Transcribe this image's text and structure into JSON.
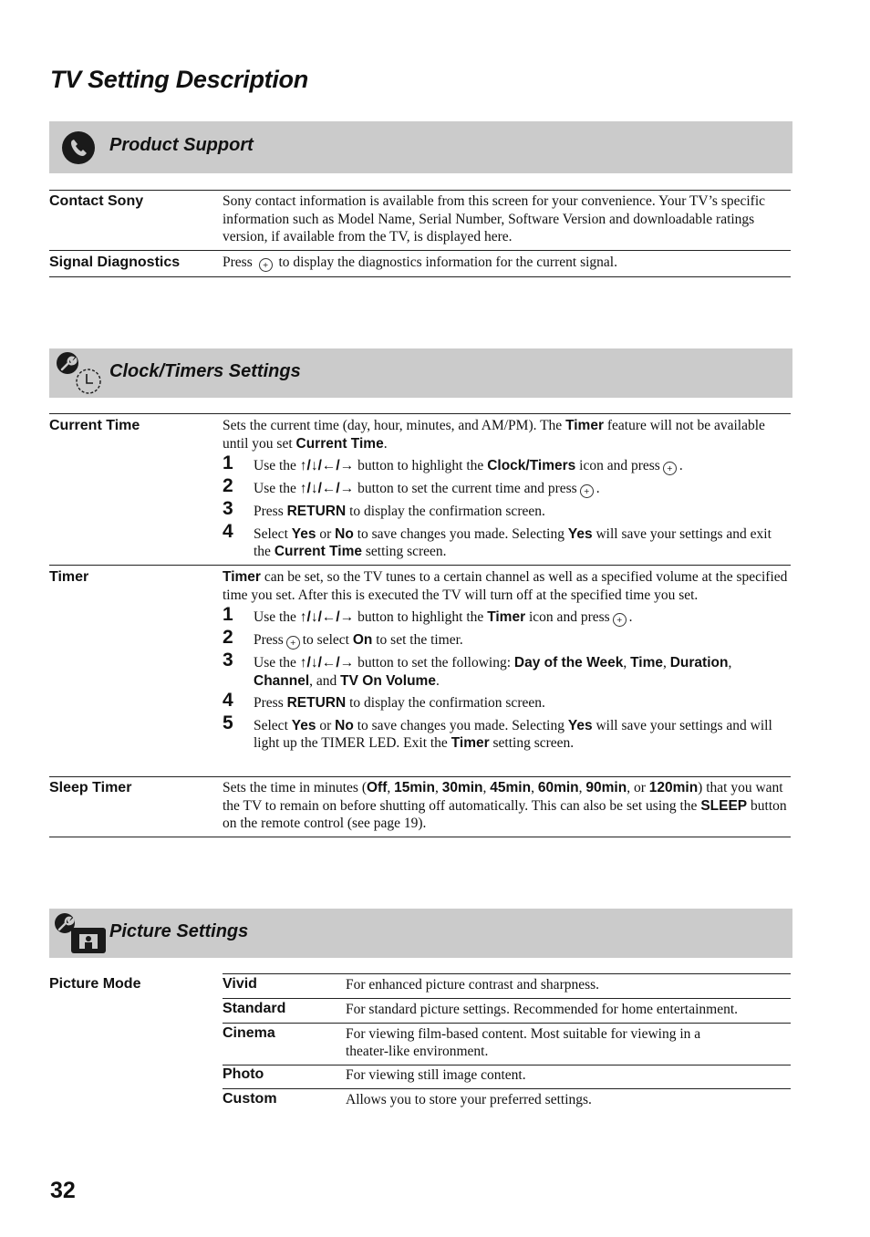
{
  "page": {
    "title": "TV Setting Description",
    "page_number": "32"
  },
  "product_support": {
    "title": "Product Support",
    "icon": "phone-icon",
    "rows": [
      {
        "label": "Contact Sony",
        "description": "Sony contact information is available from this screen for your convenience. Your TV’s specific information such as Model Name, Serial Number, Software Version and downloadable ratings version, if available from the TV, is displayed here."
      },
      {
        "label": "Signal Diagnostics",
        "description_pre": "Press",
        "description_post": "to display the diagnostics information for the current signal."
      }
    ]
  },
  "clock_timers": {
    "title": "Clock/Timers Settings",
    "icon": "wrench-clock-icon",
    "current_time": {
      "label": "Current Time",
      "intro": [
        "Sets the current time (day, hour, minutes, and AM/PM). The ",
        "Timer",
        " feature will not be available until you set ",
        "Current Time",
        "."
      ],
      "steps": [
        {
          "num": "1",
          "parts": [
            "Use the ",
            "↑/↓/←/→",
            " button to highlight the ",
            "Clock/Timers",
            " icon and press",
            "."
          ]
        },
        {
          "num": "2",
          "parts": [
            "Use the ",
            "↑/↓/←/→",
            " button to set the current time and press",
            "."
          ]
        },
        {
          "num": "3",
          "parts": [
            "Press ",
            "RETURN",
            " to display the confirmation screen."
          ]
        },
        {
          "num": "4",
          "parts": [
            "Select ",
            "Yes",
            " or ",
            "No",
            " to save changes you made. Selecting ",
            "Yes",
            " will save your settings and exit the ",
            "Current Time",
            " setting screen."
          ]
        }
      ]
    },
    "timer": {
      "label": "Timer",
      "intro": [
        "Timer",
        " can be set, so the TV tunes to a certain channel as well as a specified volume at the specified time you set. After this is executed the TV will turn off at the specified time you set."
      ],
      "steps": [
        {
          "num": "1",
          "parts": [
            "Use the ",
            "↑/↓/←/→",
            " button to highlight the ",
            "Timer",
            " icon and press",
            "."
          ]
        },
        {
          "num": "2",
          "parts": [
            "Press",
            "to select ",
            "On",
            " to set the timer."
          ]
        },
        {
          "num": "3",
          "parts": [
            "Use the ",
            "↑/↓/←/→",
            " button to set the following: ",
            "Day of the Week",
            ", ",
            "Time",
            ", ",
            "Duration",
            ", ",
            "Channel",
            ", and ",
            "TV On Volume",
            "."
          ]
        },
        {
          "num": "4",
          "parts": [
            "Press ",
            "RETURN",
            " to display the confirmation screen."
          ]
        },
        {
          "num": "5",
          "parts": [
            "Select ",
            "Yes",
            " or ",
            "No",
            " to save changes you made. Selecting ",
            "Yes",
            " will save your settings and will light up the TIMER LED. Exit the ",
            "Timer",
            " setting screen."
          ]
        }
      ]
    },
    "sleep_timer": {
      "label": "Sleep Timer",
      "parts": [
        "Sets the time in minutes (",
        "Off",
        ", ",
        "15min",
        ", ",
        "30min",
        ", ",
        "45min",
        ", ",
        "60min",
        ", ",
        "90min",
        ", or ",
        "120min",
        ") that you want the TV to remain on before shutting off automatically. This can also be set using the ",
        "SLEEP",
        " button on the remote control (see page 19)."
      ]
    }
  },
  "picture_settings": {
    "title": "Picture Settings",
    "icon": "wrench-picture-icon",
    "picture_mode": {
      "label": "Picture Mode",
      "options": [
        {
          "name": "Vivid",
          "description": "For enhanced picture contrast and sharpness."
        },
        {
          "name": "Standard",
          "description": "For standard picture settings. Recommended for home entertainment."
        },
        {
          "name": "Cinema",
          "description": "For viewing film-based content. Most suitable for viewing in a theater-like environment."
        },
        {
          "name": "Photo",
          "description": "For viewing still image content."
        },
        {
          "name": "Custom",
          "description": "Allows you to store your preferred settings."
        }
      ]
    }
  }
}
